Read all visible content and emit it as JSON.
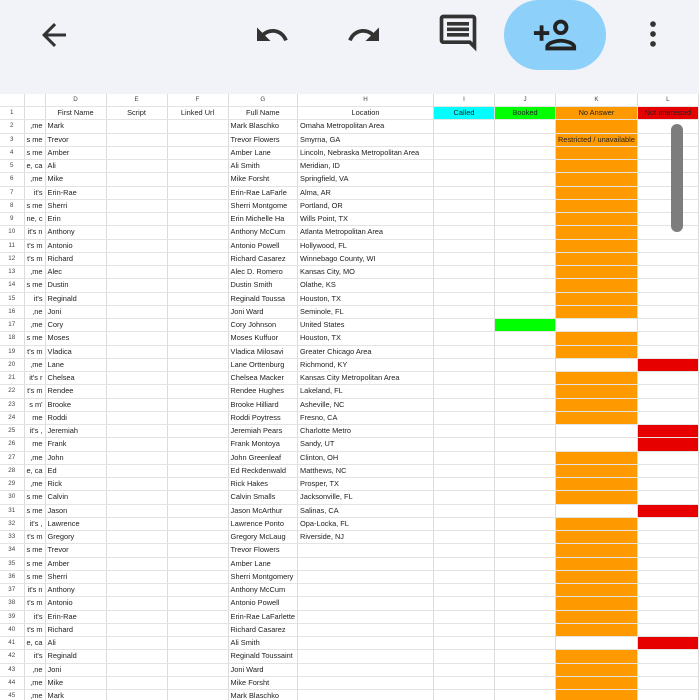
{
  "toolbar": {
    "back_icon": "arrow-back-icon",
    "undo_icon": "undo-icon",
    "redo_icon": "redo-icon",
    "comment_icon": "comment-icon",
    "share_icon": "add-person-icon",
    "more_icon": "more-vert-icon",
    "share_color": "#8dd0fa"
  },
  "sheet": {
    "column_letters": [
      "",
      "",
      "D",
      "E",
      "F",
      "G",
      "H",
      "I",
      "J",
      "K",
      "L"
    ],
    "header": {
      "row_number": "1",
      "first_name": "First Name",
      "script": "Script",
      "linked_url": "Linked Url",
      "full_name": "Full Name",
      "location": "Location",
      "called": "Called",
      "booked": "Booked",
      "no_answer": "No Answer",
      "not_interested": "Not Interested"
    },
    "colors": {
      "called": "#00ffff",
      "booked": "#00ff00",
      "no_answer": "#ff9900",
      "not_interested": "#e60000"
    },
    "rows": [
      {
        "n": "2",
        "c": "me,",
        "first": "Mark",
        "full": "Mark Blaschko",
        "loc": "Omaha Metropolitan Area",
        "j": "",
        "k": "or",
        "l": "",
        "note": ""
      },
      {
        "n": "3",
        "c": "s me",
        "first": "Trevor",
        "full": "Trevor Flowers",
        "loc": "Smyrna, GA",
        "j": "",
        "k": "or",
        "l": "",
        "note": "Restricted / unavailable"
      },
      {
        "n": "4",
        "c": "s me",
        "first": "Amber",
        "full": "Amber Lane",
        "loc": "Lincoln, Nebraska Metropolitan Area",
        "j": "",
        "k": "or",
        "l": "",
        "note": ""
      },
      {
        "n": "5",
        "c": "e, ca",
        "first": "Ali",
        "full": "Ali Smith",
        "loc": "Meridian, ID",
        "j": "",
        "k": "or",
        "l": "",
        "note": ""
      },
      {
        "n": "6",
        "c": "me,",
        "first": "Mike",
        "full": "Mike Forsht",
        "loc": "Springfield, VA",
        "j": "",
        "k": "or",
        "l": "",
        "note": ""
      },
      {
        "n": "7",
        "c": "it's",
        "first": "Erin-Rae",
        "full": "Erin-Rae LaFarle",
        "loc": "Alma, AR",
        "j": "",
        "k": "or",
        "l": "",
        "note": ""
      },
      {
        "n": "8",
        "c": "s me",
        "first": "Sherri",
        "full": "Sherri Montgome",
        "loc": "Portland, OR",
        "j": "",
        "k": "or",
        "l": "",
        "note": ""
      },
      {
        "n": "9",
        "c": "ne, c",
        "first": "Erin",
        "full": "Erin Michelle Ha",
        "loc": "Wills Point, TX",
        "j": "",
        "k": "or",
        "l": "",
        "note": ""
      },
      {
        "n": "10",
        "c": "it's n",
        "first": "Anthony",
        "full": "Anthony McCum",
        "loc": "Atlanta Metropolitan Area",
        "j": "",
        "k": "or",
        "l": "",
        "note": ""
      },
      {
        "n": "11",
        "c": "t's m",
        "first": "Antonio",
        "full": "Antonio Powell",
        "loc": "Hollywood, FL",
        "j": "",
        "k": "or",
        "l": "",
        "note": ""
      },
      {
        "n": "12",
        "c": "t's m",
        "first": "Richard",
        "full": "Richard Casarez",
        "loc": "Winnebago County, WI",
        "j": "",
        "k": "or",
        "l": "",
        "note": ""
      },
      {
        "n": "13",
        "c": "me, ",
        "first": "Alec",
        "full": "Alec D. Romero",
        "loc": "Kansas City, MO",
        "j": "",
        "k": "or",
        "l": "",
        "note": ""
      },
      {
        "n": "14",
        "c": "s me",
        "first": "Dustin",
        "full": "Dustin Smith",
        "loc": "Olathe, KS",
        "j": "",
        "k": "or",
        "l": "",
        "note": ""
      },
      {
        "n": "15",
        "c": "it's",
        "first": "Reginald",
        "full": "Reginald Toussa",
        "loc": "Houston, TX",
        "j": "",
        "k": "or",
        "l": "",
        "note": ""
      },
      {
        "n": "16",
        "c": "ne, ",
        "first": "Joni",
        "full": "Joni Ward",
        "loc": "Seminole, FL",
        "j": "",
        "k": "or",
        "l": "",
        "note": ""
      },
      {
        "n": "17",
        "c": "me, ",
        "first": "Cory",
        "full": "Cory Johnson",
        "loc": "United States",
        "j": "gr",
        "k": "",
        "l": "",
        "note": ""
      },
      {
        "n": "18",
        "c": "s me",
        "first": "Moses",
        "full": "Moses Kuffuor",
        "loc": "Houston, TX",
        "j": "",
        "k": "or",
        "l": "",
        "note": ""
      },
      {
        "n": "19",
        "c": "t's m",
        "first": "Vladica",
        "full": "Vladica Milosavi",
        "loc": "Greater Chicago Area",
        "j": "",
        "k": "or",
        "l": "",
        "note": ""
      },
      {
        "n": "20",
        "c": "me, ",
        "first": "Lane",
        "full": "Lane Orttenburg",
        "loc": "Richmond, KY",
        "j": "",
        "k": "",
        "l": "rd",
        "note": ""
      },
      {
        "n": "21",
        "c": "it's r",
        "first": "Chelsea",
        "full": "Chelsea Macker",
        "loc": "Kansas City Metropolitan Area",
        "j": "",
        "k": "or",
        "l": "",
        "note": ""
      },
      {
        "n": "22",
        "c": "t's m",
        "first": "Rendee",
        "full": "Rendee Hughes",
        "loc": "Lakeland, FL",
        "j": "",
        "k": "or",
        "l": "",
        "note": ""
      },
      {
        "n": "23",
        "c": "'s m",
        "first": "Brooke",
        "full": "Brooke Hilliard",
        "loc": "Asheville, NC",
        "j": "",
        "k": "or",
        "l": "",
        "note": ""
      },
      {
        "n": "24",
        "c": "me",
        "first": "Roddi",
        "full": "Roddi Poytress",
        "loc": "Fresno, CA",
        "j": "",
        "k": "or",
        "l": "",
        "note": ""
      },
      {
        "n": "25",
        "c": ", it's",
        "first": "Jeremiah",
        "full": "Jeremiah Pears",
        "loc": "Charlotte Metro",
        "j": "",
        "k": "",
        "l": "rd",
        "note": ""
      },
      {
        "n": "26",
        "c": "me",
        "first": "Frank",
        "full": "Frank Montoya",
        "loc": "Sandy, UT",
        "j": "",
        "k": "",
        "l": "rd",
        "note": ""
      },
      {
        "n": "27",
        "c": "me,",
        "first": "John",
        "full": "John Greenleaf",
        "loc": "Clinton, OH",
        "j": "",
        "k": "or",
        "l": "",
        "note": ""
      },
      {
        "n": "28",
        "c": "e, ca",
        "first": "Ed",
        "full": "Ed Reckdenwald",
        "loc": "Matthews, NC",
        "j": "",
        "k": "or",
        "l": "",
        "note": ""
      },
      {
        "n": "29",
        "c": "me, ",
        "first": "Rick",
        "full": "Rick Hakes",
        "loc": "Prosper, TX",
        "j": "",
        "k": "or",
        "l": "",
        "note": ""
      },
      {
        "n": "30",
        "c": "s me",
        "first": "Calvin",
        "full": "Calvin Smalls",
        "loc": "Jacksonville, FL",
        "j": "",
        "k": "or",
        "l": "",
        "note": ""
      },
      {
        "n": "31",
        "c": "s me",
        "first": "Jason",
        "full": "Jason McArthur",
        "loc": "Salinas, CA",
        "j": "",
        "k": "",
        "l": "rd",
        "note": ""
      },
      {
        "n": "32",
        "c": ", it's",
        "first": "Lawrence",
        "full": "Lawrence Ponto",
        "loc": "Opa-Locka, FL",
        "j": "",
        "k": "or",
        "l": "",
        "note": ""
      },
      {
        "n": "33",
        "c": "t's m",
        "first": "Gregory",
        "full": "Gregory McLaug",
        "loc": "Riverside, NJ",
        "j": "",
        "k": "or",
        "l": "",
        "note": ""
      },
      {
        "n": "34",
        "c": "s me",
        "first": "Trevor",
        "full": "Trevor Flowers",
        "loc": "",
        "j": "",
        "k": "or",
        "l": "",
        "note": ""
      },
      {
        "n": "35",
        "c": "s me",
        "first": "Amber",
        "full": "Amber Lane",
        "loc": "",
        "j": "",
        "k": "or",
        "l": "",
        "note": ""
      },
      {
        "n": "36",
        "c": "s me",
        "first": "Sherri",
        "full": "Sherri Montgomery",
        "loc": "",
        "j": "",
        "k": "or",
        "l": "",
        "note": ""
      },
      {
        "n": "37",
        "c": "it's n",
        "first": "Anthony",
        "full": "Anthony McCum",
        "loc": "",
        "j": "",
        "k": "or",
        "l": "",
        "note": ""
      },
      {
        "n": "38",
        "c": "t's m",
        "first": "Antonio",
        "full": "Antonio Powell",
        "loc": "",
        "j": "",
        "k": "or",
        "l": "",
        "note": ""
      },
      {
        "n": "39",
        "c": "it's",
        "first": "Erin-Rae",
        "full": "Erin-Rae LaFarlette",
        "loc": "",
        "j": "",
        "k": "or",
        "l": "",
        "note": ""
      },
      {
        "n": "40",
        "c": "t's m",
        "first": "Richard",
        "full": "Richard Casarez",
        "loc": "",
        "j": "",
        "k": "or",
        "l": "",
        "note": ""
      },
      {
        "n": "41",
        "c": "e, ca",
        "first": "Ali",
        "full": "Ali Smith",
        "loc": "",
        "j": "",
        "k": "",
        "l": "rd",
        "note": ""
      },
      {
        "n": "42",
        "c": "it's",
        "first": "Reginald",
        "full": "Reginald Toussaint",
        "loc": "",
        "j": "",
        "k": "or",
        "l": "",
        "note": ""
      },
      {
        "n": "43",
        "c": "ne, ",
        "first": "Joni",
        "full": "Joni Ward",
        "loc": "",
        "j": "",
        "k": "or",
        "l": "",
        "note": ""
      },
      {
        "n": "44",
        "c": "me, ",
        "first": "Mike",
        "full": "Mike Forsht",
        "loc": "",
        "j": "",
        "k": "or",
        "l": "",
        "note": ""
      },
      {
        "n": "45",
        "c": "me,",
        "first": "Mark",
        "full": "Mark Blaschko",
        "loc": "",
        "j": "",
        "k": "or",
        "l": "",
        "note": ""
      }
    ]
  }
}
